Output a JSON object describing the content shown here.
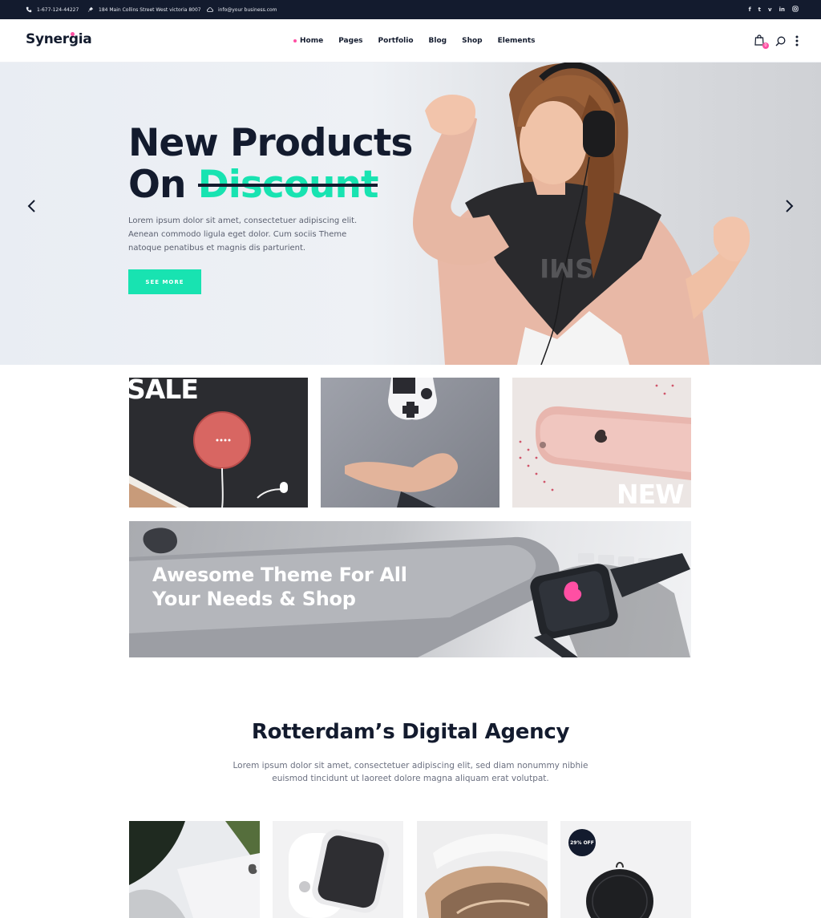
{
  "topbar": {
    "phone": "1-677-124-44227",
    "address": "184 Main Collins Street West victoria 8007",
    "email": "info@your business.com",
    "social": [
      "f",
      "t",
      "v",
      "in",
      "ig"
    ]
  },
  "header": {
    "logo": "Synergia",
    "nav": [
      "Home",
      "Pages",
      "Portfolio",
      "Blog",
      "Shop",
      "Elements"
    ],
    "cart_count": "0",
    "accent_color": "#ff4fa3"
  },
  "hero": {
    "title_line1": "New Products",
    "title_prefix": "On",
    "title_strike": "Discount",
    "text": "Lorem ipsum dolor sit amet, consectetuer adipiscing elit. Aenean commodo ligula eget dolor. Cum sociis Theme natoque penatibus et magnis dis parturient.",
    "button": "SEE MORE",
    "accent_color": "#18e3b1"
  },
  "promos": {
    "sale_label": "SALE",
    "new_label": "NEW",
    "banner_title_line1": "Awesome Theme For All",
    "banner_title_line2": "Your Needs & Shop"
  },
  "section": {
    "title": "Rotterdam’s Digital Agency",
    "text": "Lorem ipsum dolor sit amet, consectetuer adipiscing elit, sed diam nonummy nibhie euismod tincidunt ut laoreet dolore magna aliquam erat volutpat."
  },
  "products": {
    "discount_badge": "29% OFF"
  }
}
